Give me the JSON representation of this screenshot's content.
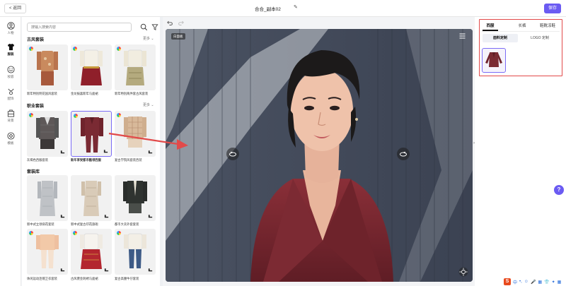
{
  "topbar": {
    "back_label": "< 返回",
    "title": "合合_副本02",
    "save_label": "保存"
  },
  "leftnav": {
    "items": [
      {
        "label": "人物",
        "icon": "person-icon"
      },
      {
        "label": "服装",
        "icon": "clothing-icon"
      },
      {
        "label": "妆容",
        "icon": "makeup-icon"
      },
      {
        "label": "配饰",
        "icon": "accessory-icon"
      },
      {
        "label": "背景",
        "icon": "background-icon"
      },
      {
        "label": "模板",
        "icon": "template-icon"
      }
    ],
    "active_index": 1
  },
  "library": {
    "search_placeholder": "搜输入搜索内容",
    "sections": [
      {
        "title": "古风套装",
        "more": "更多",
        "cards": [
          {
            "label": "新年特别明花国风套装"
          },
          {
            "label": "金龙报喜新年马面裙"
          },
          {
            "label": "新年特别两件套古风套装"
          }
        ]
      },
      {
        "title": "职业套装",
        "more": "更多",
        "cards": [
          {
            "label": "灰褐色西服套装"
          },
          {
            "label": "新年享受都市酷领西服",
            "selected": true
          },
          {
            "label": "复古学院风套装西装"
          }
        ]
      },
      {
        "title": "套装库",
        "cards": [
          {
            "label": "新中式立领抑花套装"
          },
          {
            "label": "新中式复古印花旗袍"
          },
          {
            "label": "都市大衣外套套装"
          },
          {
            "label": "休闲运动连帽卫衣套装"
          },
          {
            "label": "古风褒金刺绣马面裙"
          },
          {
            "label": "复古高腰牛仔套装"
          }
        ]
      }
    ]
  },
  "viewport": {
    "mode_tag": "白面板"
  },
  "right_panel": {
    "tabs": [
      "西服",
      "长裤",
      "鞋靴凉鞋"
    ],
    "active_tab": 0,
    "subtabs": [
      "面料定制",
      "LOGO 定制"
    ],
    "active_subtab": 0
  },
  "help_label": "?",
  "ime": {
    "logo": "S",
    "items": [
      "中",
      "•,",
      "☺",
      "🎤",
      "▦",
      "👕",
      "✦",
      "▦"
    ]
  },
  "colors": {
    "accent": "#6b5bf2",
    "frame": "#e24a4a",
    "suit": "#7a2a33"
  }
}
